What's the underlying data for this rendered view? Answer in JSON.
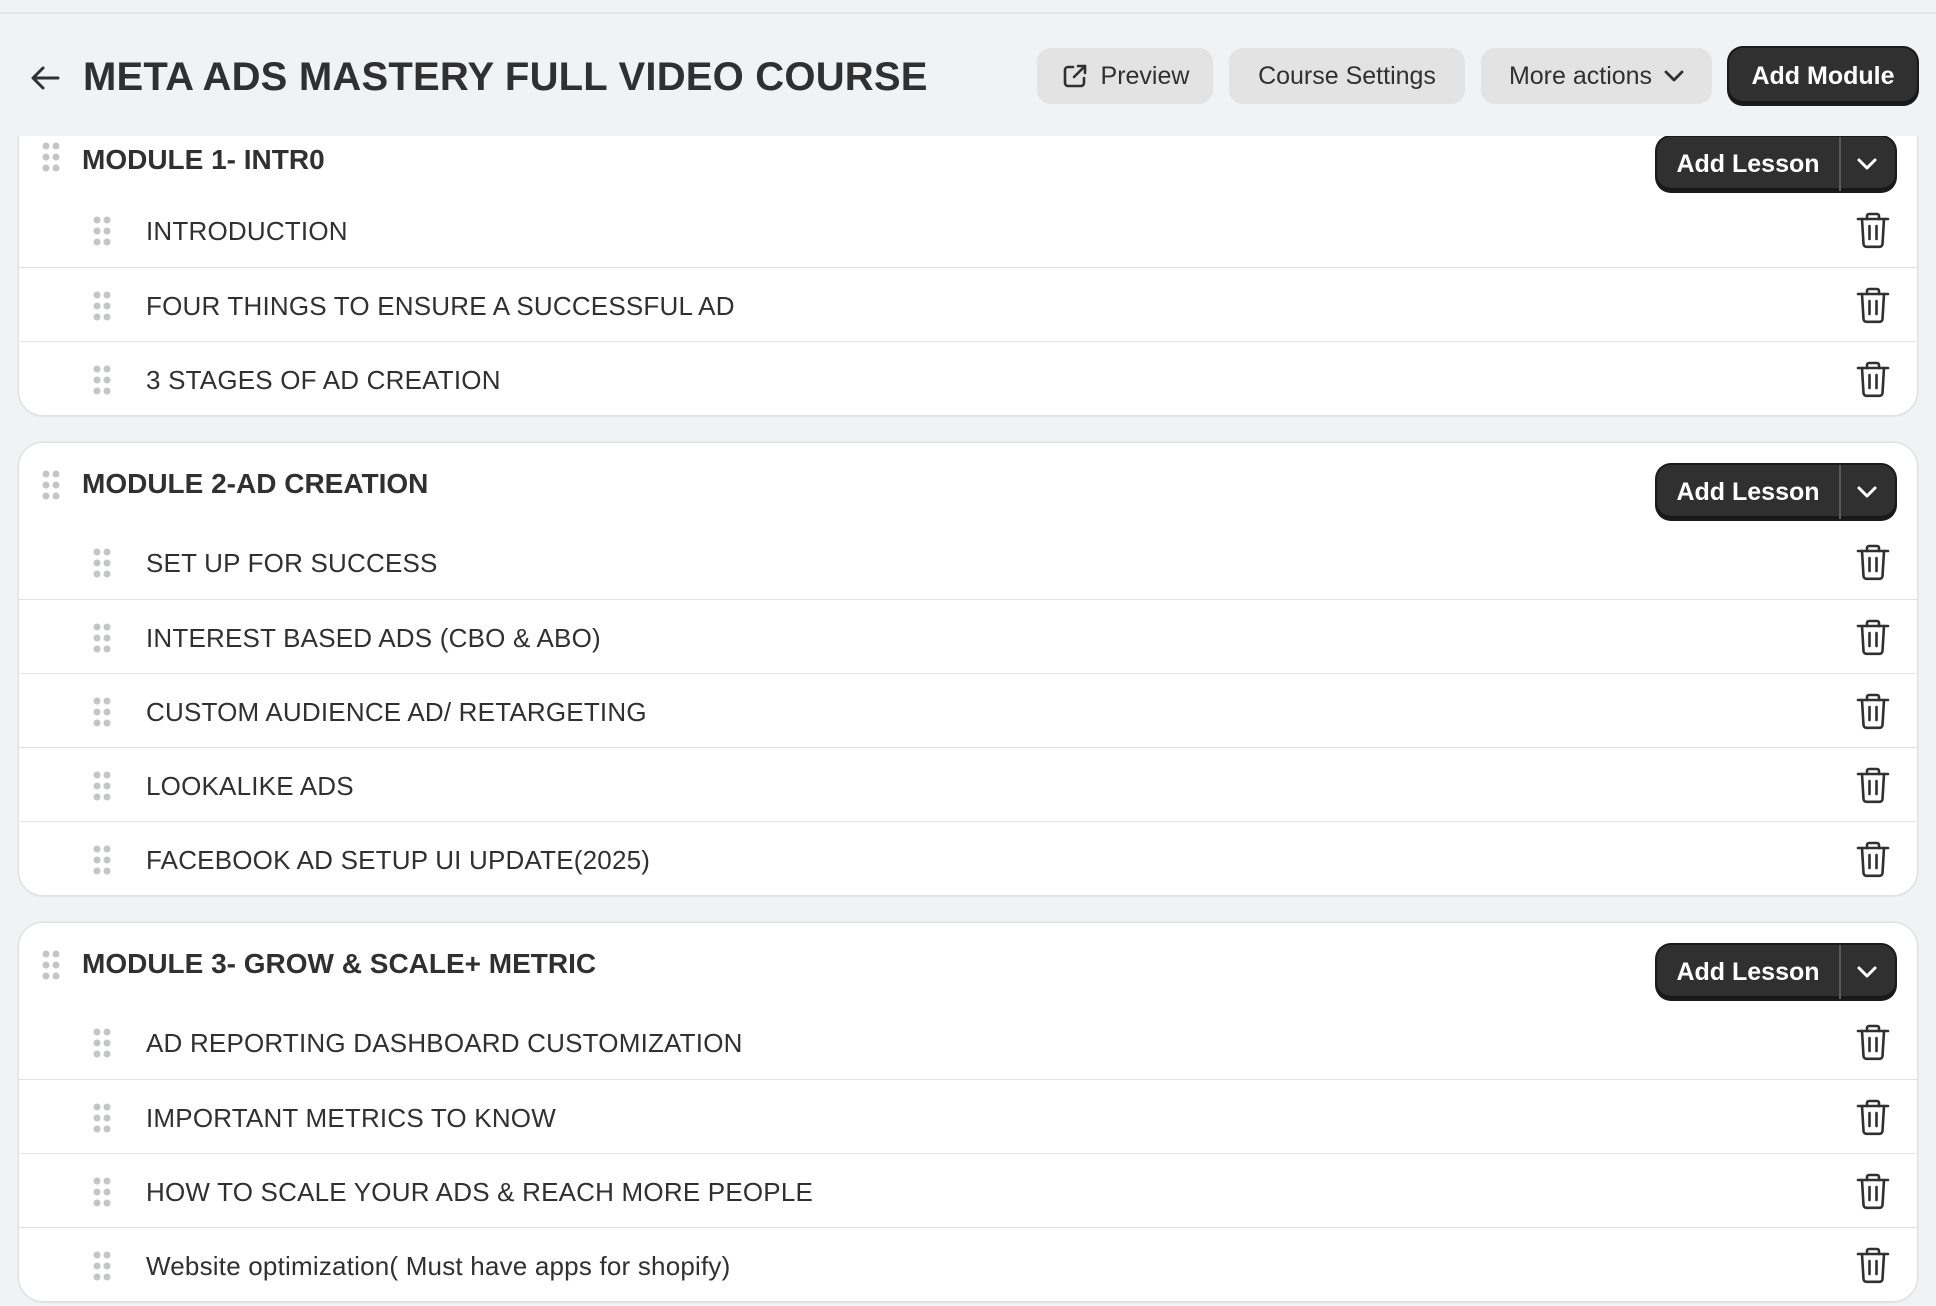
{
  "header": {
    "title": "META ADS MASTERY FULL VIDEO COURSE",
    "preview_label": "Preview",
    "settings_label": "Course Settings",
    "more_label": "More actions",
    "add_module_label": "Add Module"
  },
  "add_lesson_label": "Add Lesson",
  "modules": [
    {
      "title": "MODULE 1- INTR0",
      "lessons": [
        "INTRODUCTION",
        "FOUR THINGS TO ENSURE A SUCCESSFUL AD",
        "3 STAGES OF AD CREATION"
      ]
    },
    {
      "title": "MODULE 2-AD CREATION",
      "lessons": [
        "SET UP FOR SUCCESS",
        "INTEREST BASED ADS (CBO & ABO)",
        "CUSTOM AUDIENCE AD/ RETARGETING",
        "LOOKALIKE ADS",
        "FACEBOOK AD SETUP UI UPDATE(2025)"
      ]
    },
    {
      "title": "MODULE 3- GROW & SCALE+ METRIC",
      "lessons": [
        "AD REPORTING DASHBOARD CUSTOMIZATION",
        "IMPORTANT METRICS TO KNOW",
        "HOW TO SCALE YOUR ADS & REACH MORE PEOPLE",
        "Website optimization( Must have apps for shopify)"
      ]
    }
  ],
  "icons": {
    "back": "arrow-left-icon",
    "preview": "external-link-icon",
    "more": "chevron-down-icon",
    "drag": "drag-handle-icon",
    "delete": "trash-icon"
  }
}
